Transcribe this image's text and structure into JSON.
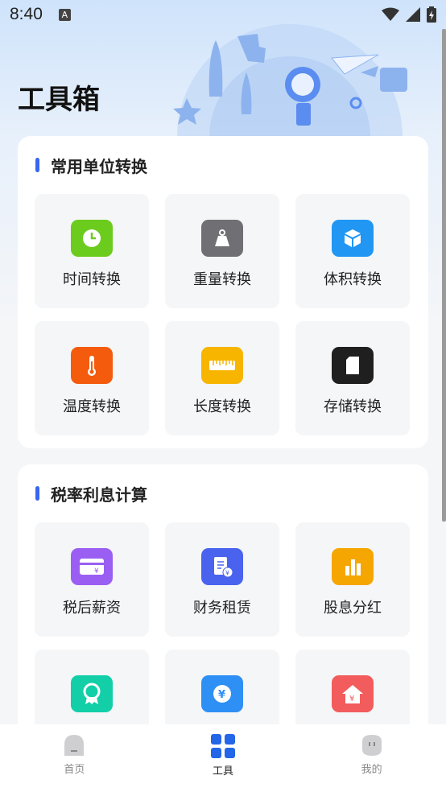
{
  "status_bar": {
    "time": "8:40",
    "notif_letter": "A"
  },
  "page_title": "工具箱",
  "sections": [
    {
      "title": "常用单位转换",
      "tools": [
        {
          "label": "时间转换",
          "icon": "clock-icon",
          "color": "#6bcc1d"
        },
        {
          "label": "重量转换",
          "icon": "weight-icon",
          "color": "#6f6f74"
        },
        {
          "label": "体积转换",
          "icon": "cube-icon",
          "color": "#2196f3"
        },
        {
          "label": "温度转换",
          "icon": "thermometer-icon",
          "color": "#f45b0c"
        },
        {
          "label": "长度转换",
          "icon": "ruler-icon",
          "color": "#f7b500"
        },
        {
          "label": "存储转换",
          "icon": "sd-card-icon",
          "color": "#1f1f1f"
        }
      ]
    },
    {
      "title": "税率利息计算",
      "tools": [
        {
          "label": "税后薪资",
          "icon": "card-yen-icon",
          "color": "#9a5ff2"
        },
        {
          "label": "财务租赁",
          "icon": "document-yen-icon",
          "color": "#4a63ef"
        },
        {
          "label": "股息分红",
          "icon": "bar-chart-icon",
          "color": "#f6a600"
        },
        {
          "label": "",
          "icon": "ribbon-icon",
          "color": "#12cfa8"
        },
        {
          "label": "",
          "icon": "yen-coin-icon",
          "color": "#2e8ff5"
        },
        {
          "label": "",
          "icon": "house-yen-icon",
          "color": "#f25c5c"
        }
      ]
    }
  ],
  "bottom_nav": [
    {
      "label": "首页",
      "icon": "home-icon",
      "active": false
    },
    {
      "label": "工具",
      "icon": "grid-icon",
      "active": true
    },
    {
      "label": "我的",
      "icon": "profile-icon",
      "active": false
    }
  ],
  "accent_color": "#3866f0"
}
